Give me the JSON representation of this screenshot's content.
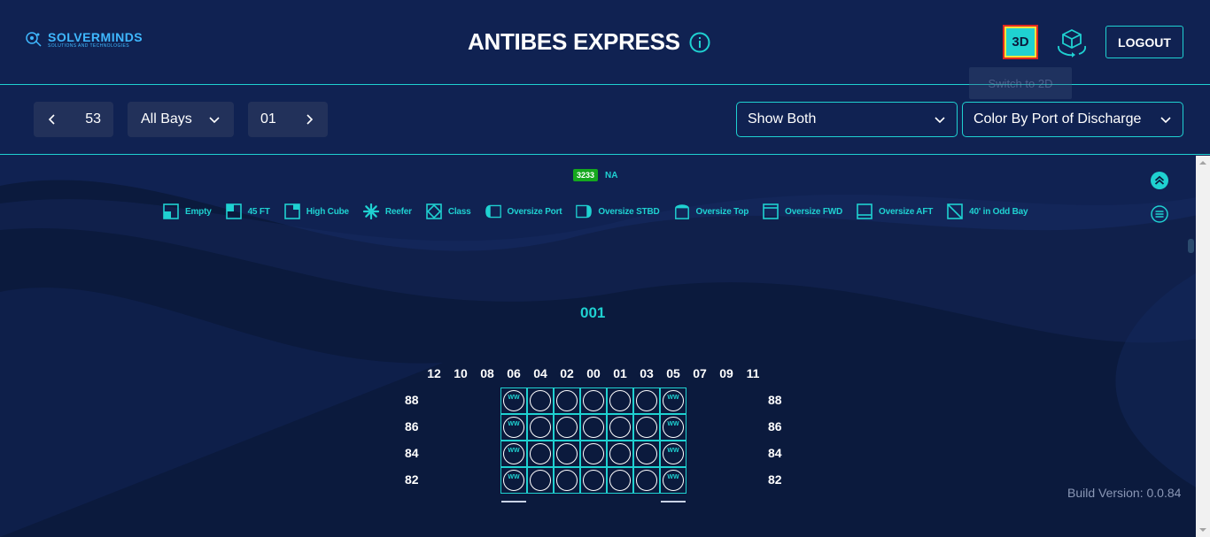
{
  "header": {
    "logo_name": "SOLVERMINDS",
    "logo_sub": "SOLUTIONS AND TECHNOLOGIES",
    "title": "ANTIBES EXPRESS",
    "btn_3d": "3D",
    "logout": "LOGOUT",
    "tooltip": "Switch to 2D"
  },
  "toolbar": {
    "row_value": "53",
    "bays_value": "All Bays",
    "tier_value": "01",
    "view_select": "Show Both",
    "color_select": "Color By Port of Discharge"
  },
  "summary": {
    "count": "3233",
    "count_label": "NA"
  },
  "legend": [
    {
      "label": "Empty",
      "icon": "empty-icon"
    },
    {
      "label": "45 FT",
      "icon": "45ft-icon"
    },
    {
      "label": "High Cube",
      "icon": "high-cube-icon"
    },
    {
      "label": "Reefer",
      "icon": "reefer-icon"
    },
    {
      "label": "Class",
      "icon": "class-icon"
    },
    {
      "label": "Oversize Port",
      "icon": "oversize-port-icon"
    },
    {
      "label": "Oversize STBD",
      "icon": "oversize-stbd-icon"
    },
    {
      "label": "Oversize Top",
      "icon": "oversize-top-icon"
    },
    {
      "label": "Oversize FWD",
      "icon": "oversize-fwd-icon"
    },
    {
      "label": "Oversize AFT",
      "icon": "oversize-aft-icon"
    },
    {
      "label": "40' in Odd Bay",
      "icon": "40ft-odd-bay-icon"
    }
  ],
  "bay": {
    "title": "001",
    "columns": [
      "12",
      "10",
      "08",
      "06",
      "04",
      "02",
      "00",
      "01",
      "03",
      "05",
      "07",
      "09",
      "11"
    ],
    "rows": [
      "88",
      "86",
      "84",
      "82"
    ],
    "cell_mark": "WW",
    "marked_columns": [
      "06",
      "05"
    ],
    "filled_columns": [
      "06",
      "04",
      "02",
      "00",
      "01",
      "03",
      "05"
    ]
  },
  "footer": {
    "build_version": "Build Version: 0.0.84"
  },
  "colors": {
    "accent": "#1fd1d1",
    "background": "#0b1a3d",
    "badge_green": "#15a81e",
    "highlight_red": "#e0281f",
    "highlight_yellow": "#f6e23a"
  }
}
